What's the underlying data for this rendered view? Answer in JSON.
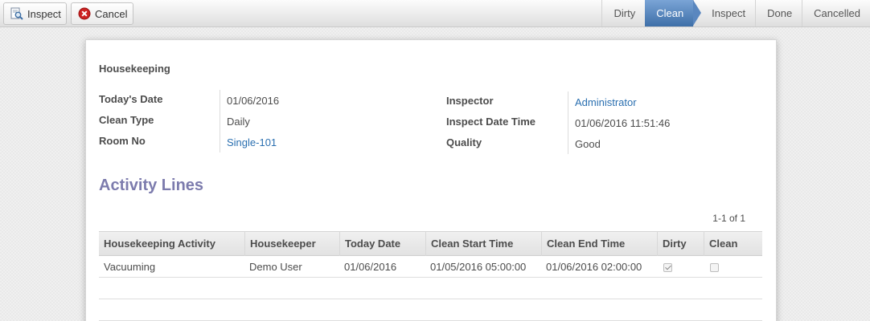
{
  "toolbar": {
    "inspect_label": "Inspect",
    "cancel_label": "Cancel"
  },
  "status_stages": [
    {
      "label": "Dirty",
      "active": false
    },
    {
      "label": "Clean",
      "active": true
    },
    {
      "label": "Inspect",
      "active": false
    },
    {
      "label": "Done",
      "active": false
    },
    {
      "label": "Cancelled",
      "active": false
    }
  ],
  "form": {
    "title": "Housekeeping",
    "left_fields": [
      {
        "label": "Today's Date",
        "value": "01/06/2016"
      },
      {
        "label": "Clean Type",
        "value": "Daily"
      },
      {
        "label": "Room No",
        "value": "Single-101"
      }
    ],
    "right_fields": [
      {
        "label": "Inspector",
        "value": "Administrator"
      },
      {
        "label": "Inspect Date Time",
        "value": "01/06/2016 11:51:46"
      },
      {
        "label": "Quality",
        "value": "Good"
      }
    ]
  },
  "activity": {
    "section_title": "Activity Lines",
    "pager": "1-1 of 1",
    "columns": [
      "Housekeeping Activity",
      "Housekeeper",
      "Today Date",
      "Clean Start Time",
      "Clean End Time",
      "Dirty",
      "Clean"
    ],
    "rows": [
      {
        "activity": "Vacuuming",
        "housekeeper": "Demo User",
        "today_date": "01/06/2016",
        "clean_start": "01/05/2016 05:00:00",
        "clean_end": "01/06/2016 02:00:00",
        "dirty": true,
        "clean": false
      }
    ]
  },
  "colors": {
    "active_stage": "#4f7fba",
    "link": "#2a6fb0",
    "section_title": "#7c7bad",
    "cancel_icon": "#cc2222"
  }
}
